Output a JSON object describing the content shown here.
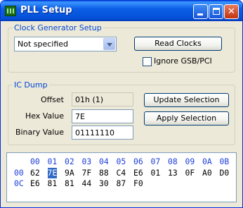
{
  "window": {
    "title": "PLL Setup"
  },
  "title_buttons": {
    "minimize_icon": "minimize-icon",
    "maximize_icon": "maximize-icon",
    "close_icon": "close-icon"
  },
  "clock_group": {
    "legend": "Clock Generator Setup",
    "select_value": "Not specified",
    "read_button": "Read Clocks",
    "ignore_checkbox_label": "Ignore GSB/PCI",
    "ignore_checked": false
  },
  "ic_group": {
    "legend": "IC Dump",
    "offset_label": "Offset",
    "offset_value": "01h (1)",
    "hex_label": "Hex Value",
    "hex_value": "7E",
    "binary_label": "Binary Value",
    "binary_value": "01111110",
    "update_button": "Update Selection",
    "apply_button": "Apply Selection"
  },
  "dump": {
    "columns": [
      "00",
      "01",
      "02",
      "03",
      "04",
      "05",
      "06",
      "07",
      "08",
      "09",
      "0A",
      "0B"
    ],
    "rows": [
      {
        "offset": "00",
        "values": [
          "62",
          "7E",
          "9A",
          "7F",
          "88",
          "C4",
          "E6",
          "01",
          "13",
          "0F",
          "A0",
          "D0"
        ]
      },
      {
        "offset": "0C",
        "values": [
          "E6",
          "81",
          "81",
          "44",
          "30",
          "87",
          "F0"
        ]
      }
    ],
    "selected": {
      "row": 0,
      "col": 1
    },
    "colors": {
      "header": "#1c3ddb",
      "selection": "#3169c6"
    }
  }
}
